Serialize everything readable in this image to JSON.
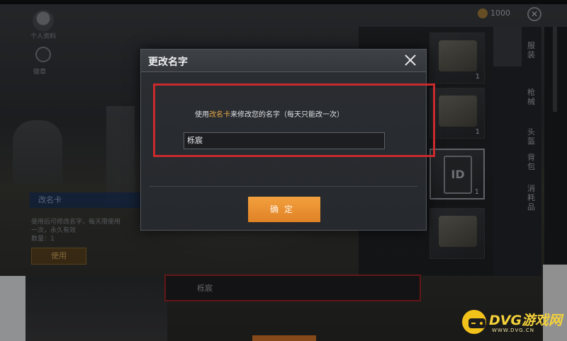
{
  "background": {
    "profile_label": "个人资料",
    "badge_label": "徽章",
    "currency_value": "1000",
    "close_symbol": "✕",
    "card_info": {
      "title": "改名卡",
      "lines": [
        "使用后可修改名字，每天限使用",
        "一次，永久有效",
        "数量：1"
      ],
      "use_button": "使用"
    },
    "inventory": {
      "counts": [
        "1",
        "1",
        "1"
      ],
      "card_glyph": "ID"
    },
    "side_tabs": [
      "服装",
      "枪械",
      "头盔",
      "背包",
      "消耗品"
    ],
    "bottom_name": "栎宸"
  },
  "dialog": {
    "title": "更改名字",
    "instruction_prefix": "使用",
    "instruction_item": "改名卡",
    "instruction_suffix": "来修改您的名字（每天只能改一次）",
    "name_value": "栎宸",
    "confirm_label": "确定"
  },
  "watermark": {
    "brand": "DVG游戏网",
    "url": "WWW.DVG.CN"
  },
  "colors": {
    "accent": "#e7a847",
    "confirm": "#df8226",
    "highlight": "#c92a2e"
  }
}
